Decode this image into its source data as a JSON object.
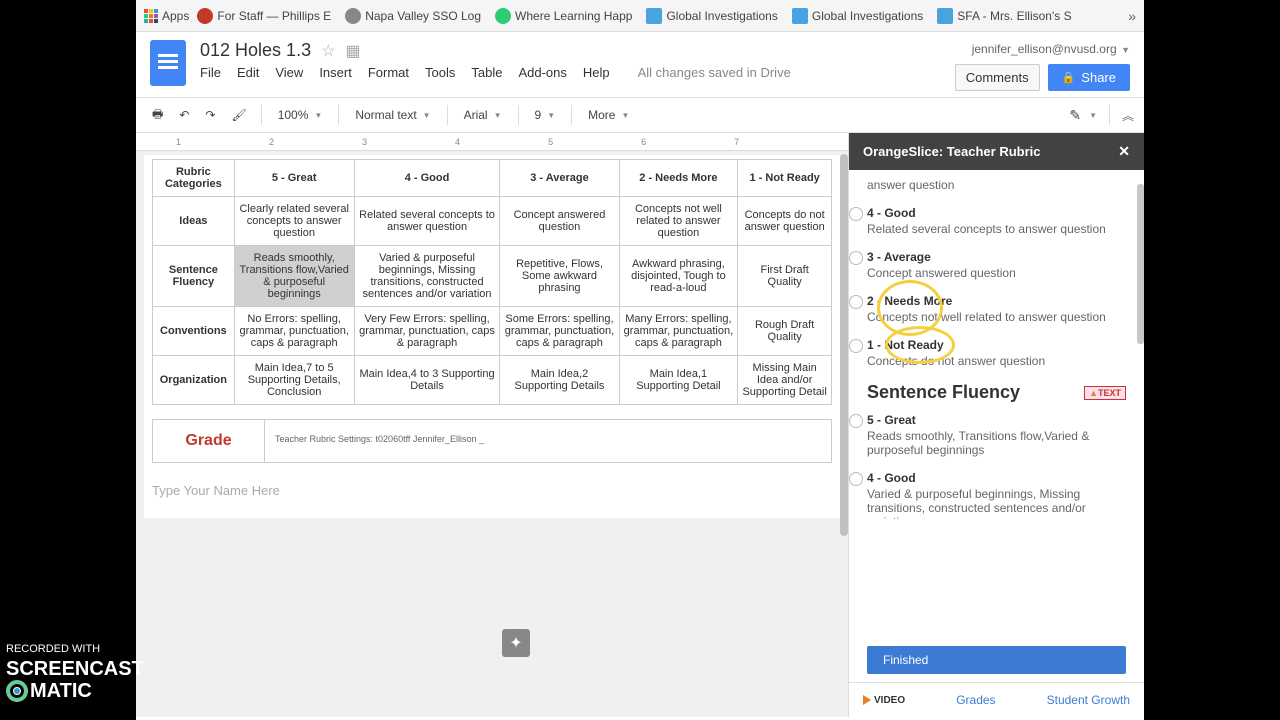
{
  "bookmarks": {
    "apps": "Apps",
    "items": [
      {
        "label": "For Staff — Phillips E",
        "color": "#c0392b"
      },
      {
        "label": "Napa Valley SSO Log",
        "color": "#808080"
      },
      {
        "label": "Where Learning Happ",
        "color": "#2ecc71"
      },
      {
        "label": "Global Investigations",
        "color": "#3498db"
      },
      {
        "label": "Global Investigations",
        "color": "#3498db"
      },
      {
        "label": "SFA - Mrs. Ellison's S",
        "color": "#3498db"
      }
    ],
    "overflow": "»"
  },
  "doc": {
    "title": "012 Holes 1.3",
    "menus": [
      "File",
      "Edit",
      "View",
      "Insert",
      "Format",
      "Tools",
      "Table",
      "Add-ons",
      "Help"
    ],
    "status": "All changes saved in Drive",
    "user_email": "jennifer_ellison@nvusd.org",
    "comments": "Comments",
    "share": "Share"
  },
  "toolbar": {
    "zoom": "100%",
    "style": "Normal text",
    "font": "Arial",
    "size": "9",
    "more": "More"
  },
  "ruler": [
    "1",
    "2",
    "3",
    "4",
    "5",
    "6",
    "7"
  ],
  "rubric": {
    "header": [
      "Rubric Categories",
      "5 - Great",
      "4 - Good",
      "3 - Average",
      "2 - Needs More",
      "1 - Not Ready"
    ],
    "rows": [
      {
        "label": "Ideas",
        "cells": [
          "Clearly related several concepts to answer question",
          "Related several concepts to answer question",
          "Concept answered question",
          "Concepts not well related to answer question",
          "Concepts do not answer question"
        ]
      },
      {
        "label": "Sentence Fluency",
        "cells": [
          "Reads smoothly, Transitions flow,Varied & purposeful beginnings",
          "Varied & purposeful beginnings, Missing transitions, constructed sentences and/or variation",
          "Repetitive, Flows, Some awkward phrasing",
          "Awkward phrasing, disjointed, Tough to read-a-loud",
          "First Draft Quality"
        ]
      },
      {
        "label": "Conventions",
        "cells": [
          "No Errors: spelling, grammar, punctuation, caps & paragraph",
          "Very Few Errors: spelling, grammar, punctuation, caps & paragraph",
          "Some Errors: spelling, grammar, punctuation, caps & paragraph",
          "Many Errors: spelling, grammar, punctuation, caps & paragraph",
          "Rough Draft Quality"
        ]
      },
      {
        "label": "Organization",
        "cells": [
          "Main Idea,7 to 5 Supporting Details, Conclusion",
          "Main Idea,4 to 3 Supporting Details",
          "Main Idea,2 Supporting Details",
          "Main Idea,1 Supporting Detail",
          "Missing Main Idea and/or Supporting Detail"
        ]
      }
    ],
    "grade_label": "Grade",
    "grade_settings": "Teacher Rubric Settings: t02060tff Jennifer_Ellison _",
    "name_placeholder": "Type Your Name Here"
  },
  "sidebar": {
    "title": "OrangeSlice: Teacher Rubric",
    "partial_top": "answer question",
    "options_ideas": [
      {
        "title": "4 - Good",
        "desc": "Related several concepts to answer question"
      },
      {
        "title": "3 - Average",
        "desc": "Concept answered question"
      },
      {
        "title": "2 - Needs More",
        "desc": "Concepts not well related to answer question"
      },
      {
        "title": "1 - Not Ready",
        "desc": "Concepts do not answer question"
      }
    ],
    "section2": "Sentence Fluency",
    "badge": "TEXT",
    "options_sf": [
      {
        "title": "5 - Great",
        "desc": "Reads smoothly, Transitions flow,Varied & purposeful beginnings"
      },
      {
        "title": "4 - Good",
        "desc": "Varied & purposeful beginnings, Missing transitions, constructed sentences and/or variation"
      }
    ],
    "finished": "Finished",
    "footer": {
      "video": "VIDEO",
      "grades": "Grades",
      "growth": "Student Growth"
    }
  },
  "watermark": {
    "line1": "RECORDED WITH",
    "line2": "SCREENCAST",
    "line3": "MATIC"
  }
}
